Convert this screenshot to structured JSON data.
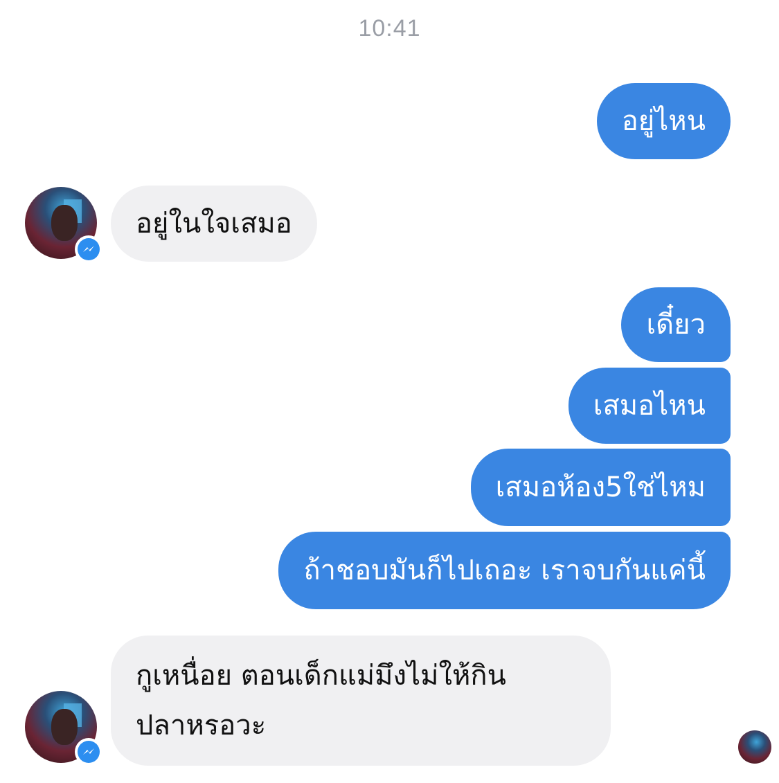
{
  "chat": {
    "timestamp": "10:41",
    "messages": [
      {
        "sender": "me",
        "text": "อยู่ไหน"
      },
      {
        "sender": "them",
        "text": "อยู่ในใจเสมอ"
      },
      {
        "sender": "me",
        "text": "เดี๋ยว"
      },
      {
        "sender": "me",
        "text": "เสมอไหน"
      },
      {
        "sender": "me",
        "text": "เสมอห้อง5ใช่ไหม"
      },
      {
        "sender": "me",
        "text": "ถ้าชอบมันก็ไปเถอะ เราจบกันแค่นี้"
      },
      {
        "sender": "them",
        "text_line1": "กูเหนื่อย ตอนเด็กแม่มึงไม่ให้กิน",
        "text_line2": "ปลาหรอวะ"
      }
    ]
  },
  "colors": {
    "outgoing_bubble": "#3a86e2",
    "incoming_bubble": "#f0f0f2",
    "timestamp_text": "#9a9ea6",
    "messenger_badge": "#2c8ef0"
  },
  "icons": {
    "contact_avatar": "contact-avatar",
    "messenger_badge": "messenger-bolt-icon",
    "seen_indicator": "seen-avatar"
  }
}
